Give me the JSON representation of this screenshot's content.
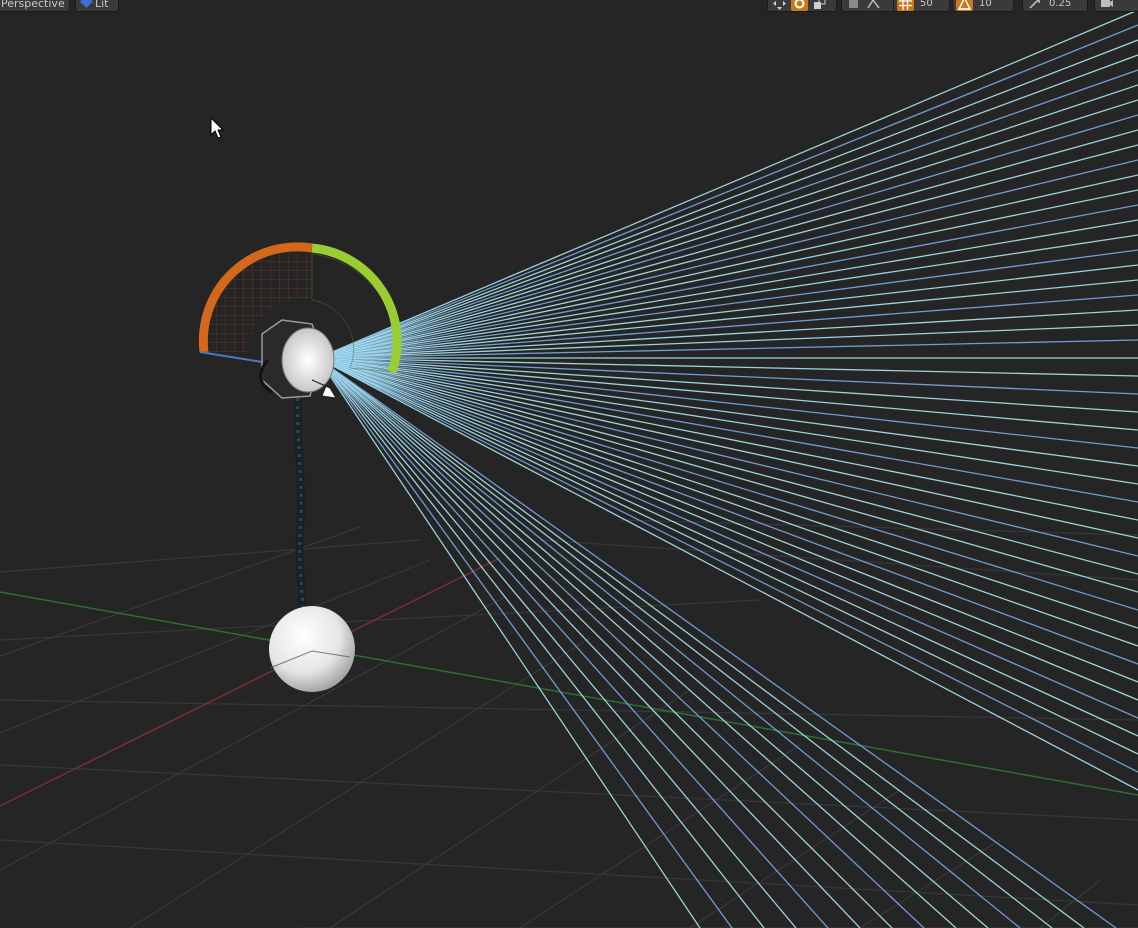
{
  "viewport": {
    "view_mode_label": "Perspective",
    "lit_label": "Lit"
  },
  "toolbar": {
    "grid_snap_value": "50",
    "rotation_snap_value": "10",
    "scale_snap_value": "0.25"
  },
  "colors": {
    "background": "#252525",
    "grid": "#3b3b3b",
    "x_axis": "#7a2e2e",
    "y_axis": "#2f6e33",
    "arc_outer": "#d3671b",
    "arc_inner": "#9acd32",
    "light_rays": "#a9e6ec",
    "light_rays_blue": "#7aa8e8",
    "active_tool": "#c77a1c"
  },
  "icons": [
    "translate-icon",
    "rotate-icon",
    "scale-icon",
    "world-local-icon",
    "surface-snap-icon",
    "grid-snap-icon",
    "rotation-snap-icon",
    "scale-snap-icon",
    "camera-speed-icon",
    "mouse-cursor-icon",
    "spotlight-icon"
  ]
}
